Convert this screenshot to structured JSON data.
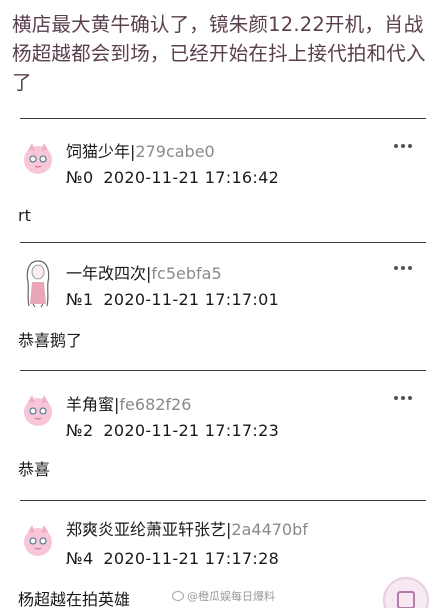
{
  "post": {
    "title": "横店最大黄牛确认了，镜朱颜12.22开机，肖战杨超越都会到场，已经开始在抖上接代拍和代入了"
  },
  "comments": [
    {
      "username": "饲猫少年",
      "separator": "|",
      "uid": "279cabe0",
      "floor": "№0",
      "timestamp": "2020-11-21 17:16:42",
      "text": "rt",
      "avatar": "jigglypuff-avatar"
    },
    {
      "username": "一年改四次",
      "separator": "|",
      "uid": "fc5ebfa5",
      "floor": "№1",
      "timestamp": "2020-11-21 17:17:01",
      "text": "恭喜鹅了",
      "avatar": "girl-sketch-avatar"
    },
    {
      "username": "羊角蜜",
      "separator": "|",
      "uid": "fe682f26",
      "floor": "№2",
      "timestamp": "2020-11-21 17:17:23",
      "text": "恭喜",
      "avatar": "jigglypuff-avatar"
    },
    {
      "username": "郑爽炎亚纶萧亚轩张艺",
      "separator": "|",
      "uid": "2a4470bf",
      "floor": "№4",
      "timestamp": "2020-11-21 17:17:28",
      "text": "杨超越在拍英雄",
      "avatar": "jigglypuff-avatar"
    }
  ],
  "watermark": {
    "text": "@橙瓜娱每日爆料"
  },
  "colors": {
    "title": "#5a3f4e",
    "uid": "#8a8a8a",
    "divider": "#3a3a3a"
  },
  "icons": {
    "more": "more-dots-icon",
    "fab": "compose-icon"
  }
}
